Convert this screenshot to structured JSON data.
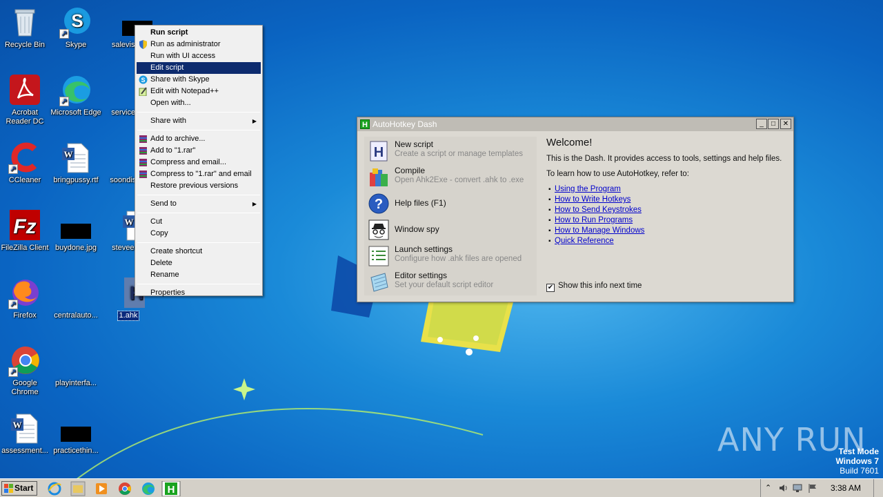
{
  "desktop": {
    "icons": [
      {
        "label": "Recycle Bin"
      },
      {
        "label": "Skype"
      },
      {
        "label": "salevisit..."
      },
      {
        "label": "Acrobat Reader DC"
      },
      {
        "label": "Microsoft Edge"
      },
      {
        "label": "services..."
      },
      {
        "label": "CCleaner"
      },
      {
        "label": "bringpussy.rtf"
      },
      {
        "label": "soondistr..."
      },
      {
        "label": "FileZilla Client"
      },
      {
        "label": "buydone.jpg"
      },
      {
        "label": "steveen..."
      },
      {
        "label": "Firefox"
      },
      {
        "label": "centralauto..."
      },
      {
        "label": "1.ahk"
      },
      {
        "label": "Google Chrome"
      },
      {
        "label": "playinterfa..."
      },
      {
        "label": "assessment..."
      },
      {
        "label": "practicethin..."
      }
    ]
  },
  "context_menu": {
    "items": [
      {
        "label": "Run script"
      },
      {
        "label": "Run as administrator"
      },
      {
        "label": "Run with UI access"
      },
      {
        "label": "Edit script"
      },
      {
        "label": "Share with Skype"
      },
      {
        "label": "Edit with Notepad++"
      },
      {
        "label": "Open with..."
      },
      {
        "label": "Share with"
      },
      {
        "label": "Add to archive..."
      },
      {
        "label": "Add to \"1.rar\""
      },
      {
        "label": "Compress and email..."
      },
      {
        "label": "Compress to \"1.rar\" and email"
      },
      {
        "label": "Restore previous versions"
      },
      {
        "label": "Send to"
      },
      {
        "label": "Cut"
      },
      {
        "label": "Copy"
      },
      {
        "label": "Create shortcut"
      },
      {
        "label": "Delete"
      },
      {
        "label": "Rename"
      },
      {
        "label": "Properties"
      }
    ]
  },
  "ahk_dash": {
    "title": "AutoHotkey Dash",
    "items": [
      {
        "title": "New script",
        "subtitle": "Create a script or manage templates"
      },
      {
        "title": "Compile",
        "subtitle": "Open Ahk2Exe - convert .ahk to .exe"
      },
      {
        "title": "Help files (F1)",
        "subtitle": ""
      },
      {
        "title": "Window spy",
        "subtitle": ""
      },
      {
        "title": "Launch settings",
        "subtitle": "Configure how .ahk files are opened"
      },
      {
        "title": "Editor settings",
        "subtitle": "Set your default script editor"
      }
    ],
    "welcome": "Welcome!",
    "desc1": "This is the Dash. It provides access to tools, settings and help files.",
    "desc2": "To learn how to use AutoHotkey, refer to:",
    "links": [
      "Using the Program",
      "How to Write Hotkeys",
      "How to Send Keystrokes",
      "How to Run Programs",
      "How to Manage Windows",
      "Quick Reference"
    ],
    "show_info_label": "Show this info next time",
    "show_info_checked": "✔"
  },
  "taskbar": {
    "start_label": "Start",
    "time": "3:38 AM"
  },
  "watermark": {
    "anyrun": "ANY RUN",
    "mode": "Test Mode",
    "os": "Windows 7",
    "build": "Build 7601"
  },
  "colors": {
    "menu_highlight": "#0d2b6e",
    "link": "#0000cc",
    "desktop_blue": "#1a8ad8"
  }
}
